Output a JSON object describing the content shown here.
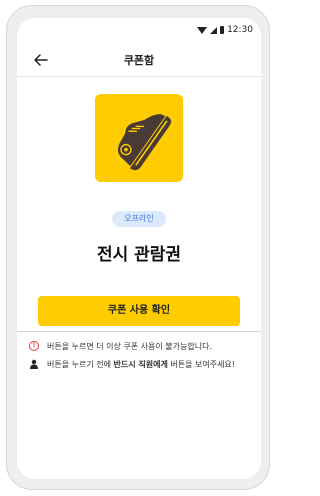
{
  "status_bar": {
    "time": "12:30"
  },
  "header": {
    "title": "쿠폰함"
  },
  "coupon": {
    "tag": "오프라인",
    "title": "전시 관람권",
    "confirm_label": "쿠폰 사용 확인"
  },
  "notices": [
    {
      "icon": "warning-icon",
      "text": "버튼을 누르면 더 이상 쿠폰 사용이 불가능합니다."
    },
    {
      "icon": "person-icon",
      "pre": "버튼을 누르기 전에 ",
      "emphasis": "반드시 직원에게",
      "post": " 버튼을 보여주세요!"
    }
  ],
  "colors": {
    "accent": "#ffcc00",
    "badge_bg": "#dbe9fb",
    "badge_text": "#3b7be0",
    "warning": "#e53935"
  }
}
